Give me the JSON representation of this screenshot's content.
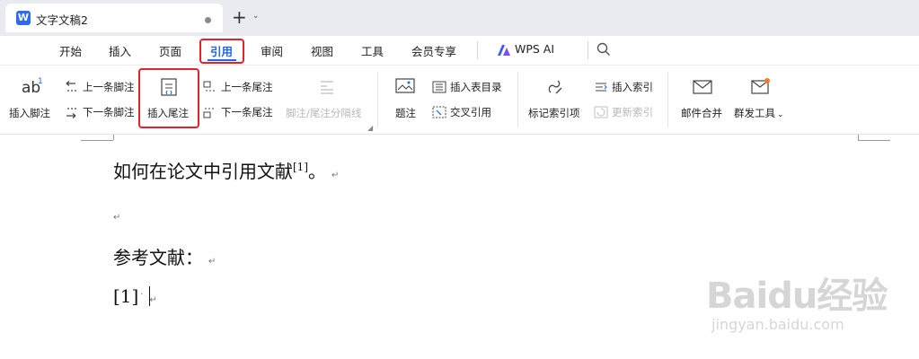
{
  "titlebar": {
    "logo_letter": "W",
    "document_name": "文字文稿2",
    "new_tab_symbol": "+",
    "new_tab_menu_symbol": "⌄"
  },
  "menu": {
    "items": [
      "开始",
      "插入",
      "页面",
      "引用",
      "审阅",
      "视图",
      "工具",
      "会员专享"
    ],
    "active": "引用",
    "wps_ai": "WPS AI",
    "accent_color": "#2464e8",
    "highlight_color": "#e8202a"
  },
  "ribbon": {
    "insert_footnote": "插入脚注",
    "prev_footnote": "上一条脚注",
    "next_footnote": "下一条脚注",
    "insert_endnote": "插入尾注",
    "prev_endnote": "上一条尾注",
    "next_endnote": "下一条尾注",
    "separator_line": "脚注/尾注分隔线",
    "caption": "题注",
    "insert_table_of_figures": "插入表目录",
    "cross_reference": "交叉引用",
    "mark_index_entry": "标记索引项",
    "insert_index": "插入索引",
    "update_index": "更新索引",
    "mail_merge": "邮件合并",
    "group_send_tools": "群发工具",
    "group_send_chevron": "⌄",
    "footnote_icon_text": "ab",
    "footnote_icon_sup": "1"
  },
  "document": {
    "line1_text": "如何在论文中引用文献",
    "line1_sup": "[1]",
    "line1_end": "。",
    "line3_text": "参考文献：",
    "line4_text": "[1]",
    "para_mark": "↵",
    "space_mark": "·"
  },
  "watermark": {
    "main": "Baidu经验",
    "sub": "jingyan.baidu.com"
  }
}
